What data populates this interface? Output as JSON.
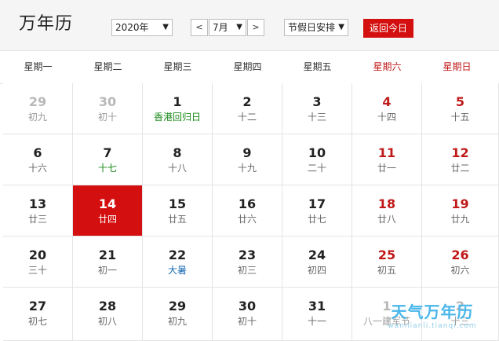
{
  "header": {
    "title": "万年历",
    "year_select": "2020年",
    "prev_label": "<",
    "month_select": "7月",
    "next_label": ">",
    "holiday_select": "节假日安排",
    "today_button": "返回今日"
  },
  "weekdays": [
    "星期一",
    "星期二",
    "星期三",
    "星期四",
    "星期五",
    "星期六",
    "星期日"
  ],
  "weeks": [
    [
      {
        "day": "29",
        "lunar": "初九",
        "type": "other"
      },
      {
        "day": "30",
        "lunar": "初十",
        "type": "other"
      },
      {
        "day": "1",
        "lunar": "香港回归日",
        "type": "festival"
      },
      {
        "day": "2",
        "lunar": "十二",
        "type": ""
      },
      {
        "day": "3",
        "lunar": "十三",
        "type": ""
      },
      {
        "day": "4",
        "lunar": "十四",
        "type": "weekend"
      },
      {
        "day": "5",
        "lunar": "十五",
        "type": "weekend"
      }
    ],
    [
      {
        "day": "6",
        "lunar": "十六",
        "type": ""
      },
      {
        "day": "7",
        "lunar": "十七",
        "type": "festival"
      },
      {
        "day": "8",
        "lunar": "十八",
        "type": ""
      },
      {
        "day": "9",
        "lunar": "十九",
        "type": ""
      },
      {
        "day": "10",
        "lunar": "二十",
        "type": ""
      },
      {
        "day": "11",
        "lunar": "廿一",
        "type": "weekend"
      },
      {
        "day": "12",
        "lunar": "廿二",
        "type": "weekend"
      }
    ],
    [
      {
        "day": "13",
        "lunar": "廿三",
        "type": ""
      },
      {
        "day": "14",
        "lunar": "廿四",
        "type": "today"
      },
      {
        "day": "15",
        "lunar": "廿五",
        "type": ""
      },
      {
        "day": "16",
        "lunar": "廿六",
        "type": ""
      },
      {
        "day": "17",
        "lunar": "廿七",
        "type": ""
      },
      {
        "day": "18",
        "lunar": "廿八",
        "type": "weekend"
      },
      {
        "day": "19",
        "lunar": "廿九",
        "type": "weekend"
      }
    ],
    [
      {
        "day": "20",
        "lunar": "三十",
        "type": ""
      },
      {
        "day": "21",
        "lunar": "初一",
        "type": ""
      },
      {
        "day": "22",
        "lunar": "大暑",
        "type": "term"
      },
      {
        "day": "23",
        "lunar": "初三",
        "type": ""
      },
      {
        "day": "24",
        "lunar": "初四",
        "type": ""
      },
      {
        "day": "25",
        "lunar": "初五",
        "type": "weekend"
      },
      {
        "day": "26",
        "lunar": "初六",
        "type": "weekend"
      }
    ],
    [
      {
        "day": "27",
        "lunar": "初七",
        "type": ""
      },
      {
        "day": "28",
        "lunar": "初八",
        "type": ""
      },
      {
        "day": "29",
        "lunar": "初九",
        "type": ""
      },
      {
        "day": "30",
        "lunar": "初十",
        "type": ""
      },
      {
        "day": "31",
        "lunar": "十一",
        "type": ""
      },
      {
        "day": "1",
        "lunar": "八一建军节",
        "type": "other"
      },
      {
        "day": "2",
        "lunar": "十三",
        "type": "other"
      }
    ]
  ],
  "watermark": {
    "title": "天气万年历",
    "url": "wannianli.tianqi.com"
  },
  "colors": {
    "accent_red": "#d40f0f",
    "weekend_red": "#c01919",
    "festival_green": "#1a8a1a",
    "solar_term_blue": "#1f6fb5",
    "watermark_blue": "#49b6ea"
  }
}
